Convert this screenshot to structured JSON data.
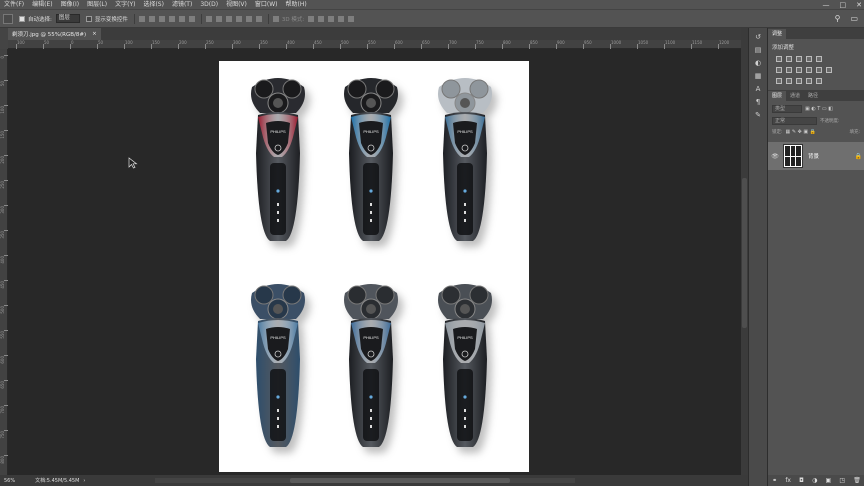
{
  "app": {
    "menu": [
      "文件(F)",
      "编辑(E)",
      "图像(I)",
      "图层(L)",
      "文字(Y)",
      "选择(S)",
      "滤镜(T)",
      "3D(D)",
      "视图(V)",
      "窗口(W)",
      "帮助(H)"
    ],
    "window_controls": [
      "—",
      "□",
      "✕"
    ]
  },
  "options": {
    "auto_select_label": "自动选择:",
    "auto_select_value": "图层",
    "show_transform_label": "显示变换控件",
    "mode_3d_label": "3D 模式:"
  },
  "document": {
    "tab_title": "剃须刀.jpg @ 55%(RGB/8#)",
    "tab_close": "×",
    "zoom": "56%",
    "doc_size": "文档:5.45M/5.45M"
  },
  "rulers": {
    "h_ticks": [
      "100",
      "50",
      "0",
      "50",
      "100",
      "150",
      "200",
      "250",
      "300",
      "350",
      "400",
      "450",
      "500",
      "550",
      "600",
      "650",
      "700",
      "750",
      "800",
      "850",
      "900",
      "950",
      "1000",
      "1050",
      "1100",
      "1150",
      "1200"
    ],
    "v_ticks": [
      "0",
      "50",
      "100",
      "150",
      "200",
      "250",
      "300",
      "350",
      "400",
      "450",
      "500",
      "550",
      "600",
      "650",
      "700",
      "750",
      "800"
    ]
  },
  "panels": {
    "tab_adjust": "调整",
    "adjust_title": "添加调整",
    "layer_tabs": [
      "图层",
      "通道",
      "路径"
    ],
    "kind_filter": "类型",
    "blend_mode": "正常",
    "opacity_label": "不透明度:",
    "lock_label": "锁定:",
    "fill_label": "填充:",
    "layer_name": "背景",
    "bottom_icons": [
      "⚭",
      "fx",
      "◘",
      "◑",
      "▣",
      "◳",
      "🗑"
    ]
  },
  "shavers": [
    {
      "body": "#1e1f23",
      "accent": "#9a1a2e",
      "head": "#2a2b30",
      "ring": "#1a1a1c"
    },
    {
      "body": "#1a1c20",
      "accent": "#1c6fa8",
      "head": "#25272b",
      "ring": "#1a1a1c"
    },
    {
      "body": "#1d1f24",
      "accent": "#3a6e96",
      "head": "#b8bec4",
      "ring": "#8f969c"
    },
    {
      "body": "#2e4e6c",
      "accent": "#4b79a0",
      "head": "#3b4f66",
      "ring": "#27384a"
    },
    {
      "body": "#1c1e22",
      "accent": "#3b6a99",
      "head": "#50555c",
      "ring": "#2a2d31"
    },
    {
      "body": "#1c1e22",
      "accent": "#8d969f",
      "head": "#4a4f55",
      "ring": "#2c2f33"
    }
  ]
}
